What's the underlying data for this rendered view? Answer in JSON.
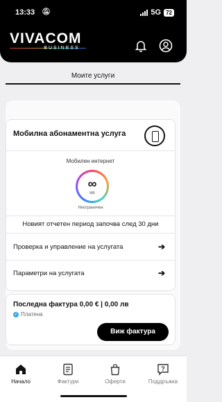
{
  "status_bar": {
    "time": "13:33",
    "network": "5G",
    "battery": "72"
  },
  "brand": {
    "name": "VIVACOM",
    "sub": "BUSINESS"
  },
  "tab": {
    "label": "Моите услуги"
  },
  "service": {
    "title": "Мобилна абонаментна услуга",
    "internet_label": "Мобилен интернет",
    "infinity": "∞",
    "unit": "MB",
    "unlimited": "Неограничен",
    "period_text": "Новият отчетен период започва след 30 дни",
    "manage": "Проверка и управление на услугата",
    "params": "Параметри на услугата"
  },
  "invoice": {
    "title": "Последна фактура 0,00 € | 0,00 лв",
    "status": "Платена",
    "button": "Виж фактура"
  },
  "nav": {
    "home": "Начало",
    "invoices": "Фактури",
    "offers": "Оферти",
    "support": "Поддръжка"
  },
  "icons": [
    "bell-icon",
    "user-icon",
    "phone-icon",
    "arrow-right-icon",
    "check-icon",
    "home-icon",
    "document-icon",
    "bag-icon",
    "help-icon"
  ],
  "colors": {
    "header": "#000000",
    "background": "#efeff1",
    "accent_check": "#3da9e0"
  }
}
